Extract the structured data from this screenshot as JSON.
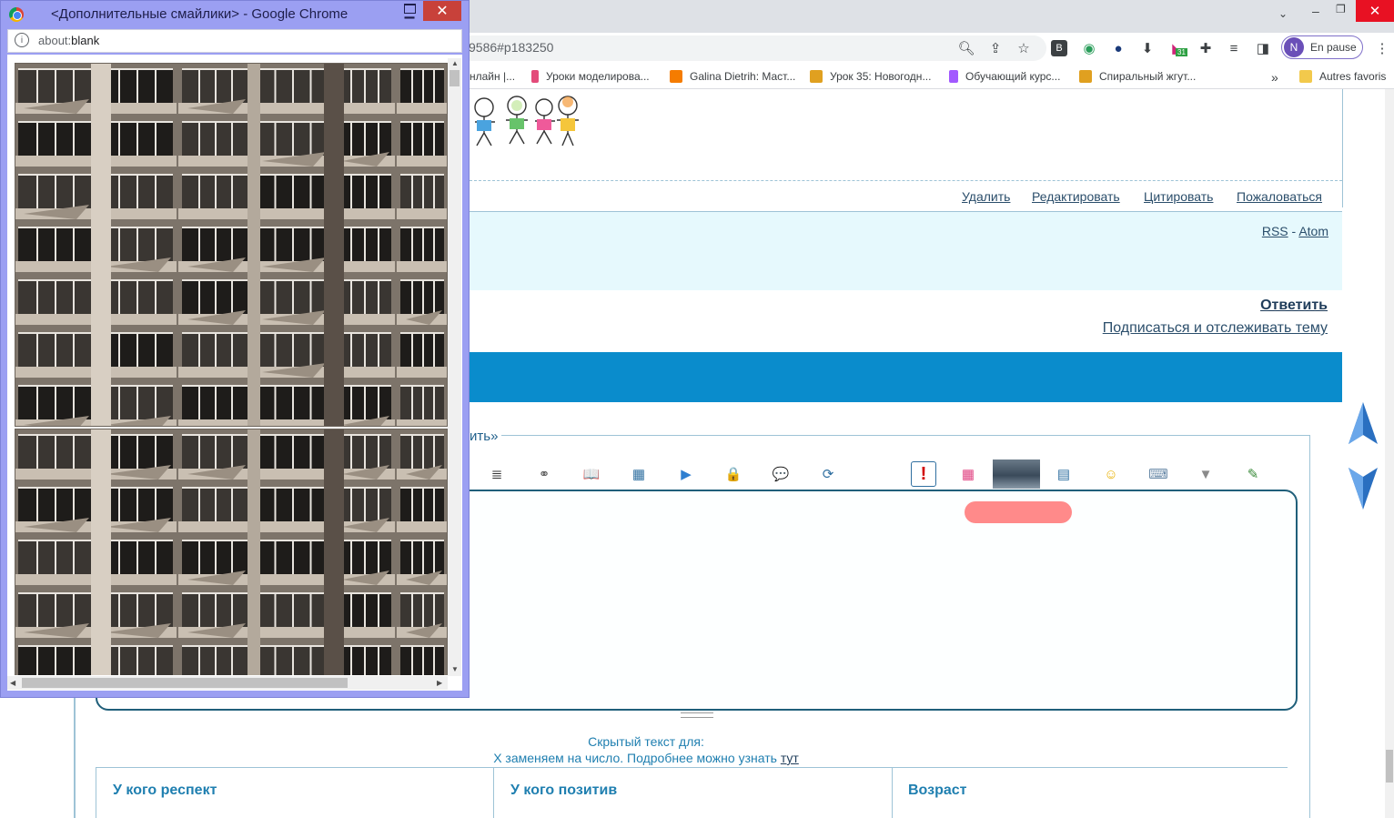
{
  "browser": {
    "url_fragment": "9586#p183250",
    "profile": {
      "initial": "N",
      "label": "En pause"
    },
    "extension_badge": "31",
    "bookmarks": [
      {
        "label": "нлайн |...",
        "color": "#ffffff"
      },
      {
        "label": "Уроки моделирова...",
        "color": "#e34b7a"
      },
      {
        "label": "Galina Dietrih: Маст...",
        "color": "#f57c00"
      },
      {
        "label": "Урок 35: Новогодн...",
        "color": "#e0a020"
      },
      {
        "label": "Обучающий курс...",
        "color": "#a259ff"
      },
      {
        "label": "Спиральный жгут...",
        "color": "#e0a020"
      }
    ],
    "bookmarks_overflow": "»",
    "other_bookmarks": "Autres favoris"
  },
  "post": {
    "actions": [
      "Удалить",
      "Редактировать",
      "Цитировать",
      "Пожаловаться"
    ]
  },
  "feeds": {
    "rss": "RSS",
    "separator": "-",
    "atom": "Atom"
  },
  "thread_actions": {
    "reply": "Ответить",
    "subscribe": "Подписаться и отслеживать тему"
  },
  "editor": {
    "legend": "ить»",
    "toolbar": [
      {
        "name": "align-right-icon",
        "glyph": "≣",
        "color": "#333333"
      },
      {
        "name": "link-icon",
        "glyph": "⚭",
        "color": "#555555"
      },
      {
        "name": "book-icon",
        "glyph": "📖",
        "color": "#2f6fa0"
      },
      {
        "name": "gallery-icon",
        "glyph": "▦",
        "color": "#2f6fa0"
      },
      {
        "name": "video-icon",
        "glyph": "▶",
        "color": "#2f7fd0"
      },
      {
        "name": "lock-icon",
        "glyph": "🔒",
        "color": "#d7a21f"
      },
      {
        "name": "speech-icon",
        "glyph": "💬",
        "color": "#2f6fa0"
      },
      {
        "name": "translate-icon",
        "glyph": "⟳",
        "color": "#2f6fa0"
      },
      {
        "name": "alert-icon",
        "glyph": "!",
        "color": "#d10000"
      },
      {
        "name": "color-palette-icon",
        "glyph": "▦",
        "color": "#e04080"
      },
      {
        "name": "image-thumb-icon",
        "glyph": "",
        "color": "#4a5a6a"
      },
      {
        "name": "table-icon",
        "glyph": "▤",
        "color": "#2f6fa0"
      },
      {
        "name": "smiley-icon",
        "glyph": "☺",
        "color": "#e8b000"
      },
      {
        "name": "keyboard-icon",
        "glyph": "⌨",
        "color": "#6a8aa8"
      },
      {
        "name": "more-dropdown-icon",
        "glyph": "▼",
        "color": "#8a8a8a"
      },
      {
        "name": "edit-note-icon",
        "glyph": "✎",
        "color": "#3a8a3a"
      }
    ]
  },
  "hidden_text": {
    "line1": "Скрытый текст для:",
    "line2": "Х заменяем на число. Подробнее можно узнать",
    "link": "тут"
  },
  "profile_table": {
    "columns": [
      "У кого респект",
      "У кого позитив",
      "Возраст"
    ]
  },
  "popup": {
    "title": "<Дополнительные смайлики> - Google Chrome",
    "url_scheme": "about:",
    "url_path": "blank",
    "images": [
      {
        "name": "ruined-building-image-1"
      },
      {
        "name": "ruined-building-image-2"
      }
    ]
  },
  "colors": {
    "accent_blue": "#0a8ccc",
    "feeds_band": "#e6f9fd",
    "popup_frame": "#9b9ff2",
    "close_red": "#c8413a"
  }
}
